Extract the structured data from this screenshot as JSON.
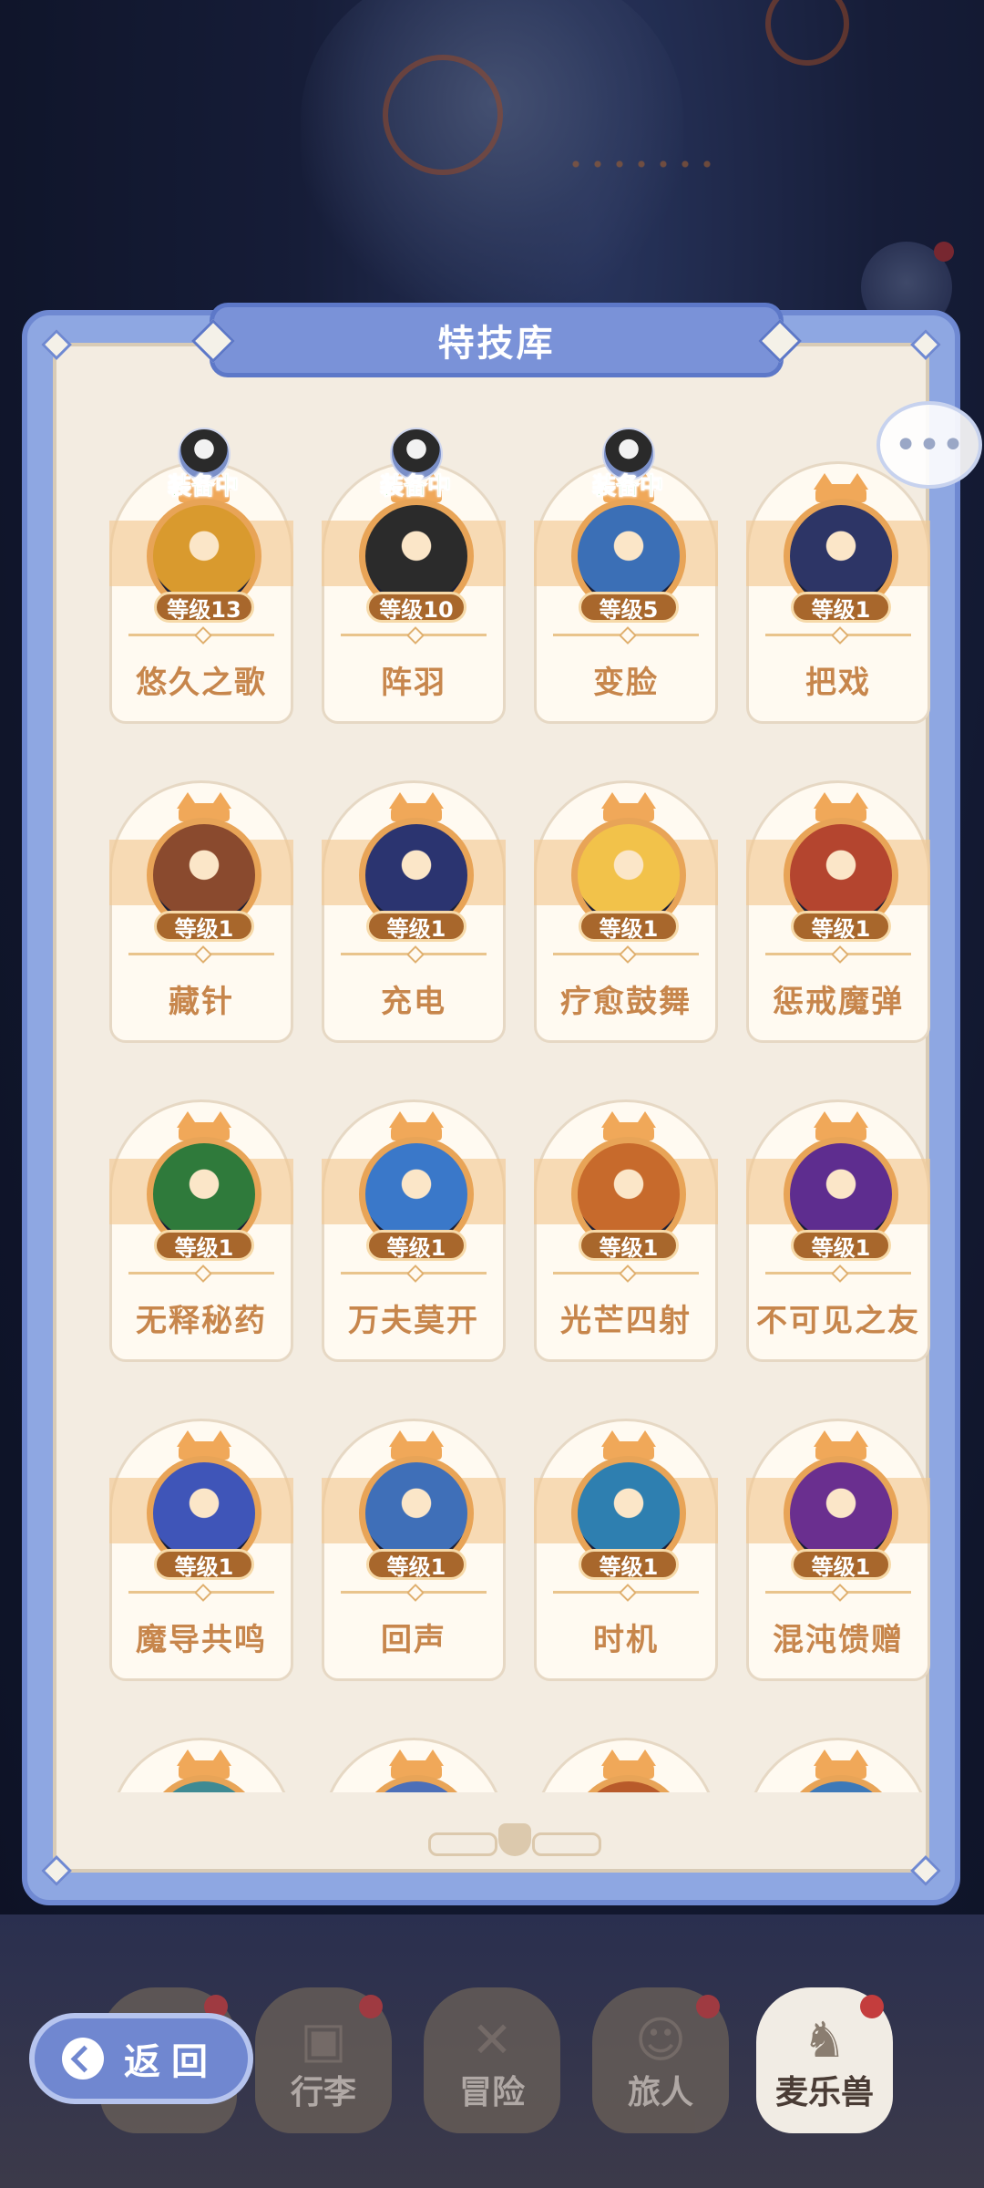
{
  "panel": {
    "title": "特技库"
  },
  "skills": [
    {
      "name": "悠久之歌",
      "level": "等级13",
      "equipped": "装备中",
      "color": "#d99a2e"
    },
    {
      "name": "阵羽",
      "level": "等级10",
      "equipped": "装备中",
      "color": "#2b2b2b"
    },
    {
      "name": "变脸",
      "level": "等级5",
      "equipped": "装备中",
      "color": "#3b6fb6"
    },
    {
      "name": "把戏",
      "level": "等级1",
      "equipped": "",
      "color": "#2d3566"
    },
    {
      "name": "藏针",
      "level": "等级1",
      "equipped": "",
      "color": "#8a4a2e"
    },
    {
      "name": "充电",
      "level": "等级1",
      "equipped": "",
      "color": "#2b3470"
    },
    {
      "name": "疗愈鼓舞",
      "level": "等级1",
      "equipped": "",
      "color": "#f2c24a"
    },
    {
      "name": "惩戒魔弹",
      "level": "等级1",
      "equipped": "",
      "color": "#b4452f"
    },
    {
      "name": "无释秘药",
      "level": "等级1",
      "equipped": "",
      "color": "#2f7a3b"
    },
    {
      "name": "万夫莫开",
      "level": "等级1",
      "equipped": "",
      "color": "#3a78c9"
    },
    {
      "name": "光芒四射",
      "level": "等级1",
      "equipped": "",
      "color": "#c76a2c"
    },
    {
      "name": "不可见之友",
      "level": "等级1",
      "equipped": "",
      "color": "#5e2d8f"
    },
    {
      "name": "魔导共鸣",
      "level": "等级1",
      "equipped": "",
      "color": "#3f55b8"
    },
    {
      "name": "回声",
      "level": "等级1",
      "equipped": "",
      "color": "#3f6fb8"
    },
    {
      "name": "时机",
      "level": "等级1",
      "equipped": "",
      "color": "#2e7fb0"
    },
    {
      "name": "混沌馈赠",
      "level": "等级1",
      "equipped": "",
      "color": "#6a2f8f"
    },
    {
      "name": "",
      "level": "",
      "equipped": "",
      "color": "#3e8a93"
    },
    {
      "name": "",
      "level": "",
      "equipped": "",
      "color": "#4c6fb8"
    },
    {
      "name": "",
      "level": "",
      "equipped": "",
      "color": "#b85a2a"
    },
    {
      "name": "",
      "level": "",
      "equipped": "",
      "color": "#3d79b8"
    }
  ],
  "bottom_nav": [
    {
      "label": "",
      "icon": "hero-icon",
      "badge": true,
      "active": false
    },
    {
      "label": "行李",
      "icon": "chest-icon",
      "badge": true,
      "active": false
    },
    {
      "label": "冒险",
      "icon": "crossed-swords-icon",
      "badge": false,
      "active": false
    },
    {
      "label": "旅人",
      "icon": "traveler-icon",
      "badge": true,
      "active": false
    },
    {
      "label": "麦乐兽",
      "icon": "beast-icon",
      "badge": true,
      "active": true
    }
  ],
  "back_button": {
    "label": "返回"
  }
}
